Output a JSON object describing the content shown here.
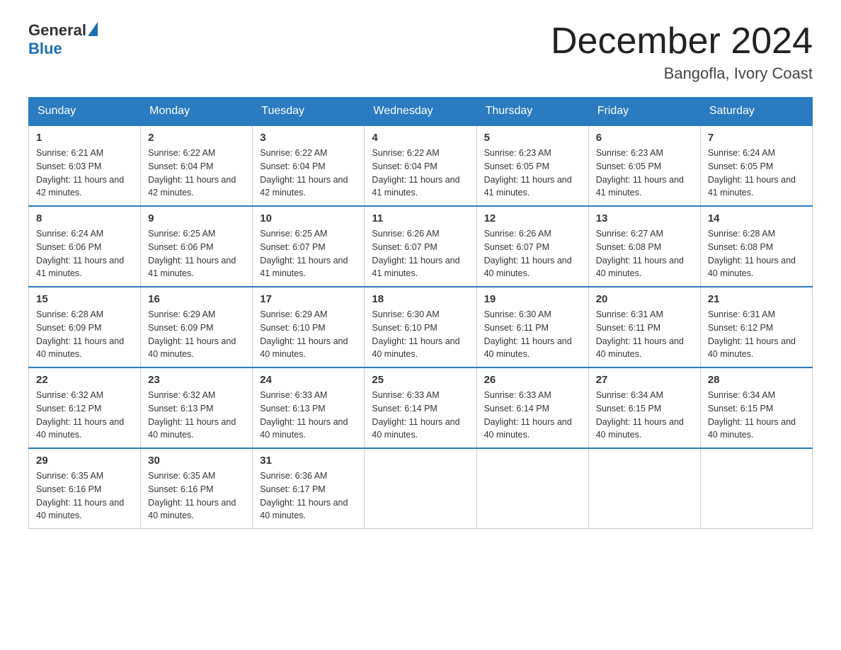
{
  "header": {
    "logo_general": "General",
    "logo_blue": "Blue",
    "month_title": "December 2024",
    "location": "Bangofla, Ivory Coast"
  },
  "days_of_week": [
    "Sunday",
    "Monday",
    "Tuesday",
    "Wednesday",
    "Thursday",
    "Friday",
    "Saturday"
  ],
  "weeks": [
    [
      {
        "day": "1",
        "sunrise": "6:21 AM",
        "sunset": "6:03 PM",
        "daylight": "11 hours and 42 minutes."
      },
      {
        "day": "2",
        "sunrise": "6:22 AM",
        "sunset": "6:04 PM",
        "daylight": "11 hours and 42 minutes."
      },
      {
        "day": "3",
        "sunrise": "6:22 AM",
        "sunset": "6:04 PM",
        "daylight": "11 hours and 42 minutes."
      },
      {
        "day": "4",
        "sunrise": "6:22 AM",
        "sunset": "6:04 PM",
        "daylight": "11 hours and 41 minutes."
      },
      {
        "day": "5",
        "sunrise": "6:23 AM",
        "sunset": "6:05 PM",
        "daylight": "11 hours and 41 minutes."
      },
      {
        "day": "6",
        "sunrise": "6:23 AM",
        "sunset": "6:05 PM",
        "daylight": "11 hours and 41 minutes."
      },
      {
        "day": "7",
        "sunrise": "6:24 AM",
        "sunset": "6:05 PM",
        "daylight": "11 hours and 41 minutes."
      }
    ],
    [
      {
        "day": "8",
        "sunrise": "6:24 AM",
        "sunset": "6:06 PM",
        "daylight": "11 hours and 41 minutes."
      },
      {
        "day": "9",
        "sunrise": "6:25 AM",
        "sunset": "6:06 PM",
        "daylight": "11 hours and 41 minutes."
      },
      {
        "day": "10",
        "sunrise": "6:25 AM",
        "sunset": "6:07 PM",
        "daylight": "11 hours and 41 minutes."
      },
      {
        "day": "11",
        "sunrise": "6:26 AM",
        "sunset": "6:07 PM",
        "daylight": "11 hours and 41 minutes."
      },
      {
        "day": "12",
        "sunrise": "6:26 AM",
        "sunset": "6:07 PM",
        "daylight": "11 hours and 40 minutes."
      },
      {
        "day": "13",
        "sunrise": "6:27 AM",
        "sunset": "6:08 PM",
        "daylight": "11 hours and 40 minutes."
      },
      {
        "day": "14",
        "sunrise": "6:28 AM",
        "sunset": "6:08 PM",
        "daylight": "11 hours and 40 minutes."
      }
    ],
    [
      {
        "day": "15",
        "sunrise": "6:28 AM",
        "sunset": "6:09 PM",
        "daylight": "11 hours and 40 minutes."
      },
      {
        "day": "16",
        "sunrise": "6:29 AM",
        "sunset": "6:09 PM",
        "daylight": "11 hours and 40 minutes."
      },
      {
        "day": "17",
        "sunrise": "6:29 AM",
        "sunset": "6:10 PM",
        "daylight": "11 hours and 40 minutes."
      },
      {
        "day": "18",
        "sunrise": "6:30 AM",
        "sunset": "6:10 PM",
        "daylight": "11 hours and 40 minutes."
      },
      {
        "day": "19",
        "sunrise": "6:30 AM",
        "sunset": "6:11 PM",
        "daylight": "11 hours and 40 minutes."
      },
      {
        "day": "20",
        "sunrise": "6:31 AM",
        "sunset": "6:11 PM",
        "daylight": "11 hours and 40 minutes."
      },
      {
        "day": "21",
        "sunrise": "6:31 AM",
        "sunset": "6:12 PM",
        "daylight": "11 hours and 40 minutes."
      }
    ],
    [
      {
        "day": "22",
        "sunrise": "6:32 AM",
        "sunset": "6:12 PM",
        "daylight": "11 hours and 40 minutes."
      },
      {
        "day": "23",
        "sunrise": "6:32 AM",
        "sunset": "6:13 PM",
        "daylight": "11 hours and 40 minutes."
      },
      {
        "day": "24",
        "sunrise": "6:33 AM",
        "sunset": "6:13 PM",
        "daylight": "11 hours and 40 minutes."
      },
      {
        "day": "25",
        "sunrise": "6:33 AM",
        "sunset": "6:14 PM",
        "daylight": "11 hours and 40 minutes."
      },
      {
        "day": "26",
        "sunrise": "6:33 AM",
        "sunset": "6:14 PM",
        "daylight": "11 hours and 40 minutes."
      },
      {
        "day": "27",
        "sunrise": "6:34 AM",
        "sunset": "6:15 PM",
        "daylight": "11 hours and 40 minutes."
      },
      {
        "day": "28",
        "sunrise": "6:34 AM",
        "sunset": "6:15 PM",
        "daylight": "11 hours and 40 minutes."
      }
    ],
    [
      {
        "day": "29",
        "sunrise": "6:35 AM",
        "sunset": "6:16 PM",
        "daylight": "11 hours and 40 minutes."
      },
      {
        "day": "30",
        "sunrise": "6:35 AM",
        "sunset": "6:16 PM",
        "daylight": "11 hours and 40 minutes."
      },
      {
        "day": "31",
        "sunrise": "6:36 AM",
        "sunset": "6:17 PM",
        "daylight": "11 hours and 40 minutes."
      },
      null,
      null,
      null,
      null
    ]
  ],
  "labels": {
    "sunrise": "Sunrise:",
    "sunset": "Sunset:",
    "daylight": "Daylight:"
  }
}
